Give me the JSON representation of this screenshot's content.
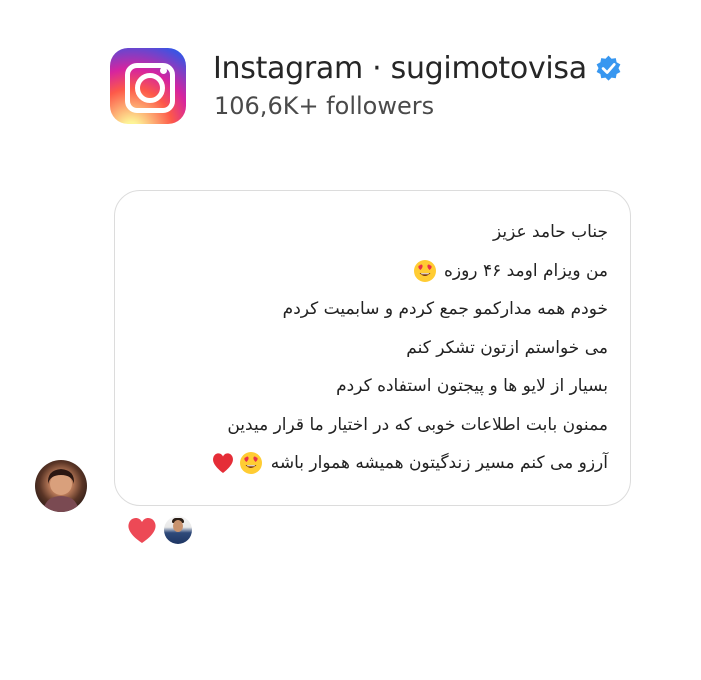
{
  "header": {
    "title": "Instagram · sugimotovisa",
    "followers": "106,6K+ followers",
    "verified_icon": "verified-badge-icon",
    "logo_icon": "instagram-logo-icon"
  },
  "message": {
    "lines": [
      {
        "text": "جناب حامد عزیز",
        "emojis": []
      },
      {
        "text": "من ویزام اومد ۴۶ روزه",
        "emojis": [
          "heart-eyes"
        ]
      },
      {
        "text": "خودم همه مدارکمو جمع کردم و سابمیت کردم",
        "emojis": []
      },
      {
        "text": "می خواستم ازتون تشکر کنم",
        "emojis": []
      },
      {
        "text": "بسیار از لایو ها و پیجتون استفاده کردم",
        "emojis": []
      },
      {
        "text": "ممنون بابت اطلاعات خوبی که در اختیار ما قرار میدین",
        "emojis": []
      },
      {
        "text": "آرزو می کنم مسیر زندگیتون همیشه هموار باشه",
        "emojis": [
          "heart-eyes",
          "red-heart"
        ]
      }
    ]
  },
  "reactions": [
    "red-heart-reaction",
    "reactor-avatar"
  ],
  "colors": {
    "verified": "#3897f0",
    "heart": "#ed4956",
    "bubble_border": "#dcdcdc"
  }
}
